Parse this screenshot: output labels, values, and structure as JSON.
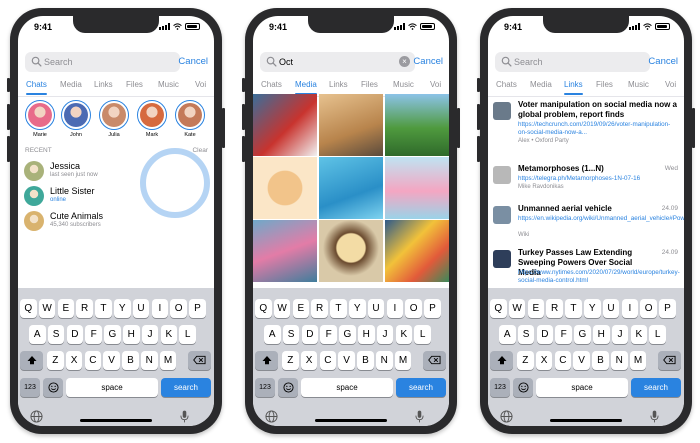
{
  "status_time": "9:41",
  "phone1": {
    "search_placeholder": "Search",
    "cancel": "Cancel",
    "tabs": [
      "Chats",
      "Media",
      "Links",
      "Files",
      "Music",
      "Voi"
    ],
    "active_tab": 0,
    "stories": [
      {
        "name": "Marie",
        "color": "#e86b8a"
      },
      {
        "name": "John",
        "color": "#4c6bb3"
      },
      {
        "name": "Julia",
        "color": "#c98a6a"
      },
      {
        "name": "Mark",
        "color": "#d66a3f"
      },
      {
        "name": "Kate",
        "color": "#c47a5a"
      }
    ],
    "recent_label": "RECENT",
    "recent_clear": "Clear",
    "chats": [
      {
        "name": "Jessica",
        "sub": "last seen just now",
        "online": false,
        "color": "#a9b27a"
      },
      {
        "name": "Little Sister",
        "sub": "online",
        "online": true,
        "color": "#3fa89a"
      },
      {
        "name": "Cute Animals",
        "sub": "45,340 subscribers",
        "online": false,
        "color": "#d9b36e"
      }
    ]
  },
  "phone2": {
    "search_value": "Oct",
    "cancel": "Cancel",
    "tabs": [
      "Chats",
      "Media",
      "Links",
      "Files",
      "Music",
      "Voi"
    ],
    "active_tab": 1,
    "media": [
      {
        "icon": "red-car-icon",
        "bg": "linear-gradient(135deg,#3a6e9a,#c8332e 55%,#f1f1f1)"
      },
      {
        "icon": "desert-road-icon",
        "bg": "linear-gradient(160deg,#e7c28f,#b8844c 60%,#5a4a3c)"
      },
      {
        "icon": "green-valley-icon",
        "bg": "linear-gradient(180deg,#8cc3e8,#4f9a3e 55%,#2f6a2b)"
      },
      {
        "icon": "toast-cat-icon",
        "bg": "radial-gradient(circle at 50% 50%,#f2c48a 0 38%,#fbe6c7 40%)"
      },
      {
        "icon": "pool-swimmer-icon",
        "bg": "linear-gradient(160deg,#5fc3e6,#2a8fc7 60%,#7fd3ef)"
      },
      {
        "icon": "donut-stack-icon",
        "bg": "linear-gradient(180deg,#bfe3f2,#f4a6c2 55%,#9ad3e8)"
      },
      {
        "icon": "pink-flowers-icon",
        "bg": "linear-gradient(160deg,#6fa9c9,#e37ca7 50%,#3f7d9c)"
      },
      {
        "icon": "latte-cup-icon",
        "bg": "radial-gradient(circle at 50% 45%,#f3dca5 0 30%,#6a4a2e 33%,#d9c9a8 60%)"
      },
      {
        "icon": "paint-pots-icon",
        "bg": "linear-gradient(135deg,#2e5a8a,#f2c23a 40%,#e25a3a 70%,#3a8a5a)"
      }
    ]
  },
  "phone3": {
    "search_placeholder": "Search",
    "cancel": "Cancel",
    "tabs": [
      "Chats",
      "Media",
      "Links",
      "Files",
      "Music",
      "Voi"
    ],
    "active_tab": 2,
    "links": [
      {
        "title": "Voter manipulation on social media now a global problem, report finds",
        "url": "https://techcrunch.com/2019/09/26/voter-manipulation-on-social-media-now-a...",
        "source": "Alex • Oxford Party",
        "date": "",
        "color": "#6a7a8a"
      },
      {
        "title": "Metamorphoses (1...N)",
        "url": "https://telegra.ph/Metamorphoses-1N-07-16",
        "source": "Mike Ravdonikas",
        "date": "Wed",
        "color": "#b8b8b8"
      },
      {
        "title": "Unmanned aerial vehicle",
        "url": "https://en.wikipedia.org/wiki/Unmanned_aerial_vehicle#Power_supply...",
        "source": "Wiki",
        "date": "24.09",
        "color": "#7a8fa3"
      },
      {
        "title": "Turkey Passes Law Extending Sweeping Powers Over Social Media",
        "url": "https://www.nytimes.com/2020/07/29/world/europe/turkey-social-media-control.html",
        "source": "",
        "date": "24.09",
        "color": "#2e3e5a"
      }
    ]
  },
  "keyboard": {
    "row1": [
      "Q",
      "W",
      "E",
      "R",
      "T",
      "Y",
      "U",
      "I",
      "O",
      "P"
    ],
    "row2": [
      "A",
      "S",
      "D",
      "F",
      "G",
      "H",
      "J",
      "K",
      "L"
    ],
    "row3": [
      "Z",
      "X",
      "C",
      "V",
      "B",
      "N",
      "M"
    ],
    "numbers": "123",
    "space": "space",
    "search": "search"
  },
  "colors": {
    "accent": "#2a83e0",
    "phone_body": "#2a2a2c",
    "keyboard_bg": "#d1d3d9"
  }
}
